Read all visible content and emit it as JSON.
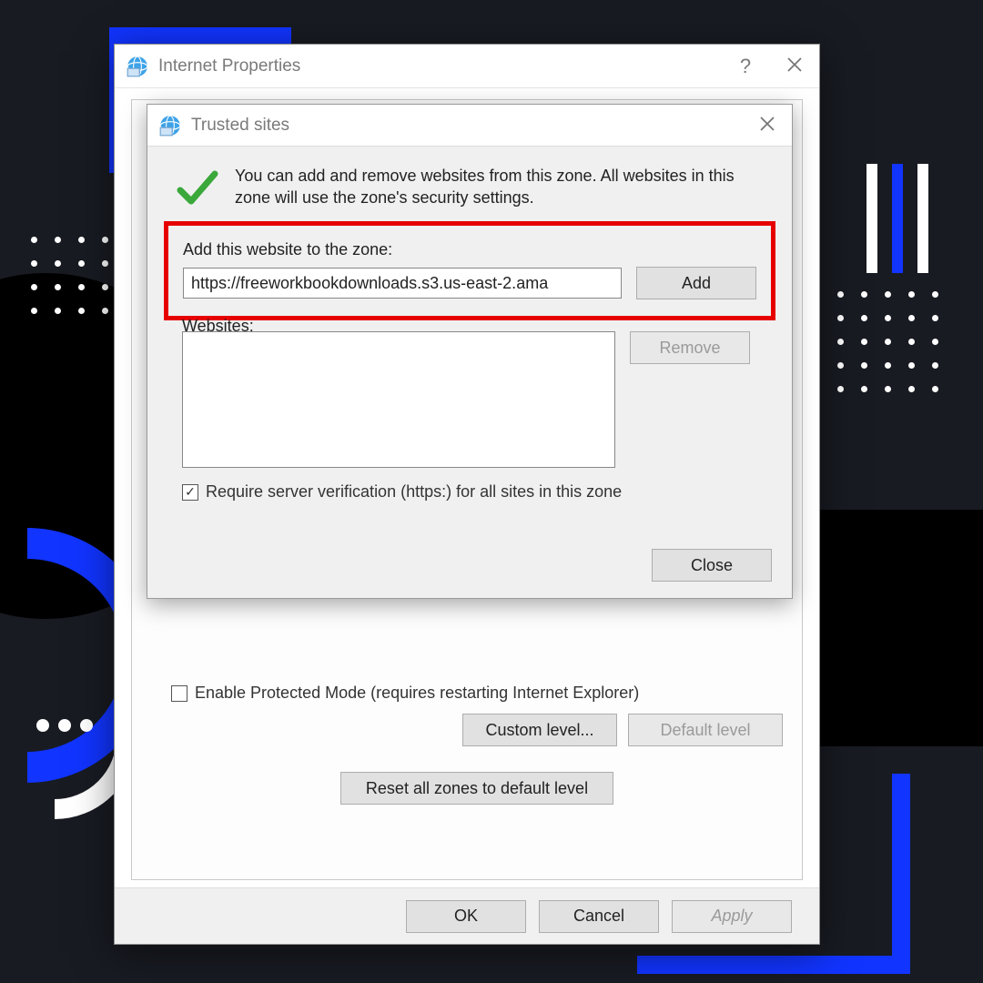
{
  "decor": {},
  "parentWindow": {
    "title": "Internet Properties",
    "help": "?",
    "body": {
      "enableProtected": {
        "checked": false,
        "label": "Enable Protected Mode (requires restarting Internet Explorer)"
      },
      "customLevel": "Custom level...",
      "defaultLevel": "Default level",
      "resetZones": "Reset all zones to default level"
    },
    "footer": {
      "ok": "OK",
      "cancel": "Cancel",
      "apply": "Apply"
    }
  },
  "childDialog": {
    "title": "Trusted sites",
    "intro": "You can add and remove websites from this zone. All websites in this zone will use the zone's security settings.",
    "addLabel": "Add this website to the zone:",
    "urlValue": "https://freeworkbookdownloads.s3.us-east-2.ama",
    "addBtn": "Add",
    "websitesLabel": "Websites:",
    "removeBtn": "Remove",
    "requireHttps": {
      "checked": true,
      "label": "Require server verification (https:) for all sites in this zone"
    },
    "closeBtn": "Close"
  }
}
